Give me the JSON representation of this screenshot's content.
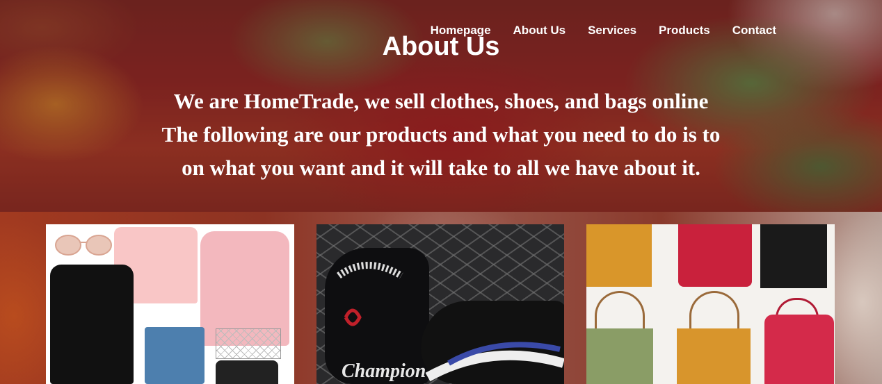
{
  "nav": {
    "items": [
      {
        "label": "Homepage"
      },
      {
        "label": "About Us"
      },
      {
        "label": "Services"
      },
      {
        "label": "Products"
      },
      {
        "label": "Contact"
      }
    ]
  },
  "hero": {
    "title": "About Us",
    "lines": [
      "We are HomeTrade, we sell clothes, shoes, and bags online",
      "The following are our products and what you need to do is to",
      "on what you want and it will take to all we have about it."
    ]
  },
  "products": [
    {
      "name": "clothes-collage",
      "icon": "clothing-image"
    },
    {
      "name": "shoes-photo",
      "icon": "sneaker-image",
      "brand_text": "Champion"
    },
    {
      "name": "bags-collage",
      "icon": "bags-image"
    }
  ]
}
